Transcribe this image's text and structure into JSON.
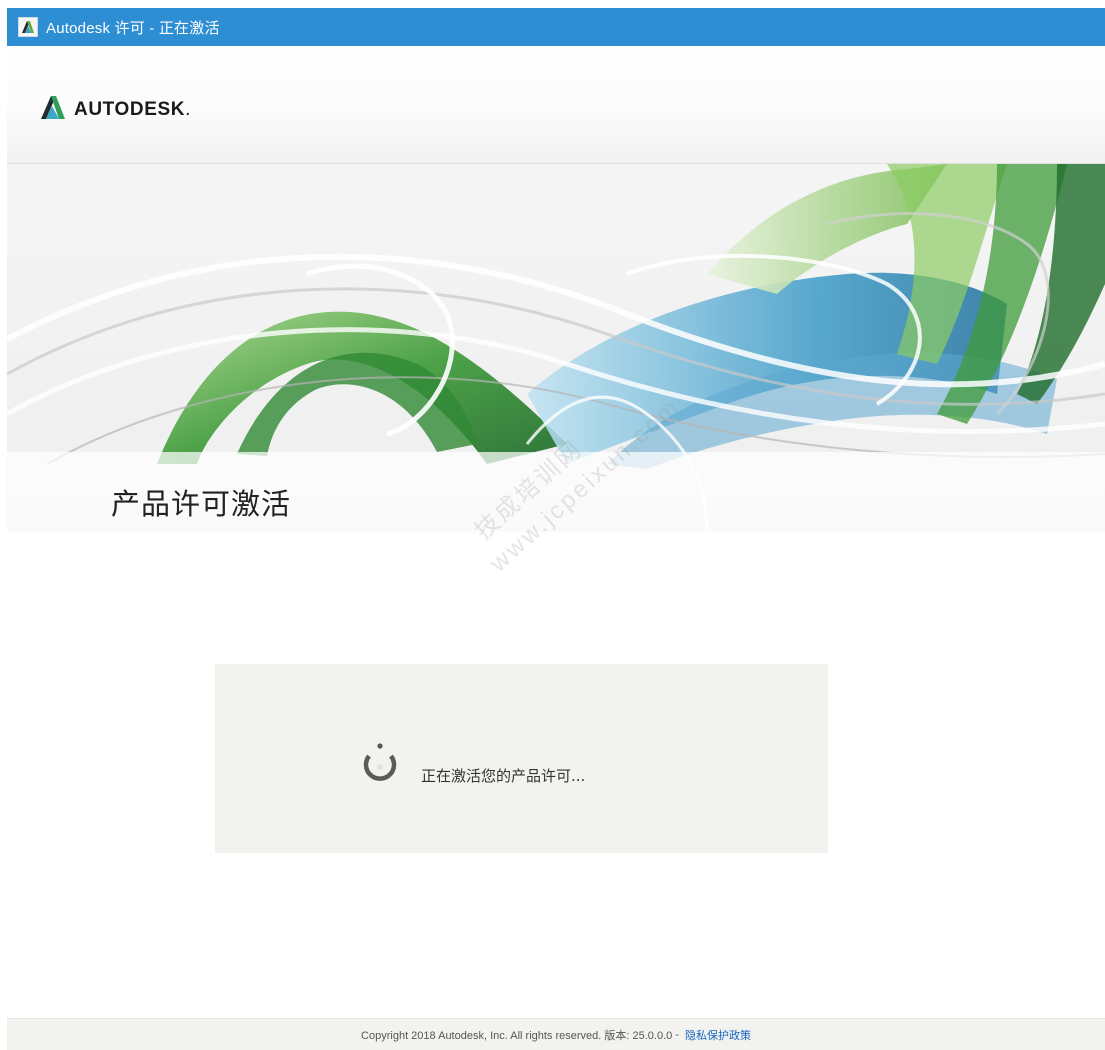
{
  "window": {
    "title": "Autodesk 许可 - 正在激活"
  },
  "header": {
    "logo_text": "AUTODESK",
    "logo_mark": "."
  },
  "banner": {
    "title": "产品许可激活"
  },
  "watermark": {
    "line1": "技成培训网",
    "line2": "www.jcpeixun.com"
  },
  "status": {
    "message": "正在激活您的产品许可..."
  },
  "footer": {
    "copyright": "Copyright 2018 Autodesk, Inc. All rights reserved. 版本: 25.0.0.0",
    "separator": "-",
    "privacy_link": "隐私保护政策"
  },
  "colors": {
    "titlebar": "#2e8ed3",
    "accent_green": "#5fae43",
    "accent_blue": "#3d9bc8",
    "status_bg": "#f2f2ee",
    "link": "#1565c0"
  },
  "icons": [
    "autodesk-app-icon",
    "autodesk-logo-icon",
    "loading-spinner-icon"
  ]
}
